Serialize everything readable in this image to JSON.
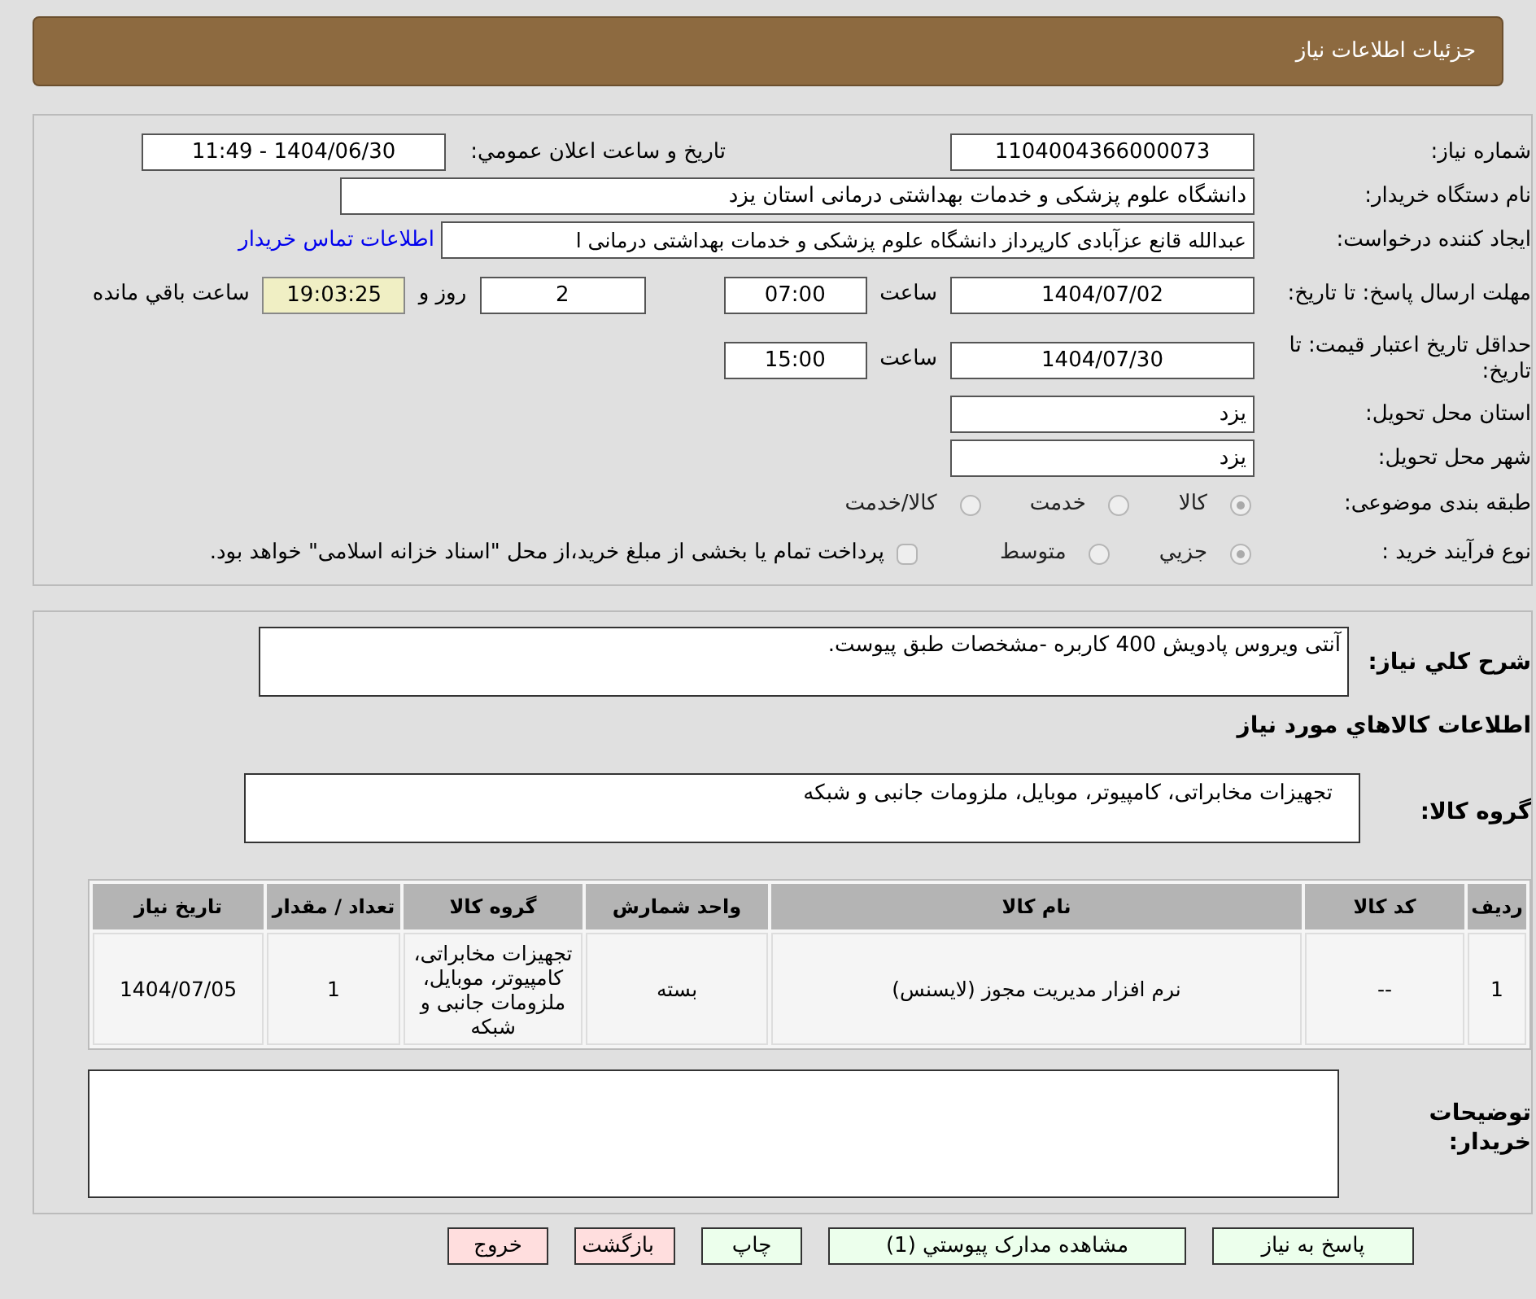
{
  "header": {
    "title": "جزئیات اطلاعات نیاز"
  },
  "need_number": {
    "label": "شماره نیاز:",
    "value": "1104004366000073"
  },
  "announce": {
    "label": "تاریخ و ساعت اعلان عمومي:",
    "value": "1404/06/30 - 11:49"
  },
  "buyer_org": {
    "label": "نام دستگاه خریدار:",
    "value": "دانشگاه علوم پزشکی و خدمات بهداشتی  درمانی استان یزد"
  },
  "requester": {
    "label": "ایجاد کننده درخواست:",
    "value": "عبدالله قانع عزآبادی کارپرداز دانشگاه علوم پزشکی و خدمات بهداشتی  درمانی ا",
    "link": "اطلاعات تماس خریدار"
  },
  "deadline": {
    "label": "مهلت ارسال پاسخ: تا تاریخ:",
    "date": "1404/07/02",
    "time_label": "ساعت",
    "time": "07:00",
    "days": "2",
    "days_label": "روز و",
    "remaining": "19:03:25",
    "remaining_label": "ساعت باقي مانده"
  },
  "validity": {
    "label": "حداقل تاریخ اعتبار قیمت: تا تاریخ:",
    "date": "1404/07/30",
    "time_label": "ساعت",
    "time": "15:00"
  },
  "province": {
    "label": "استان محل تحویل:",
    "value": "یزد"
  },
  "city": {
    "label": "شهر محل تحویل:",
    "value": "یزد"
  },
  "category": {
    "label": "طبقه بندی موضوعی:",
    "options": [
      {
        "label": "کالا",
        "selected": true
      },
      {
        "label": "خدمت",
        "selected": false
      },
      {
        "label": "کالا/خدمت",
        "selected": false
      }
    ]
  },
  "process": {
    "label": "نوع فرآیند خرید :",
    "options": [
      {
        "label": "جزيي",
        "selected": true
      },
      {
        "label": "متوسط",
        "selected": false
      }
    ],
    "payment": {
      "label": "پرداخت تمام یا بخشی از مبلغ خرید،از محل \"اسناد خزانه اسلامی\" خواهد بود.",
      "checked": false
    }
  },
  "description": {
    "label": "شرح کلي نياز:",
    "value": "آنتی ویروس پادویش 400 کاربره -مشخصات طبق پیوست."
  },
  "goods_title": "اطلاعات کالاهاي مورد نياز",
  "goods_group": {
    "label": "گروه کالا:",
    "value": "تجهیزات مخابراتی، کامپیوتر، موبایل، ملزومات جانبی و شبکه"
  },
  "table": {
    "columns": [
      "رديف",
      "کد کالا",
      "نام کالا",
      "واحد شمارش",
      "گروه کالا",
      "تعداد / مقدار",
      "تاریخ نیاز"
    ],
    "rows": [
      [
        "1",
        "--",
        "نرم افزار مدیریت مجوز (لایسنس)",
        "بسته",
        "تجهیزات مخابراتی، کامپیوتر، موبایل، ملزومات جانبی و شبکه",
        "1",
        "1404/07/05"
      ]
    ]
  },
  "buyer_notes": {
    "label": "توضیحات خریدار:"
  },
  "buttons": [
    {
      "label": "پاسخ به نیاز",
      "kind": "primary"
    },
    {
      "label": "مشاهده مدارک پیوستي (1)",
      "kind": "primary"
    },
    {
      "label": "چاپ",
      "kind": "primary"
    },
    {
      "label": "بازگشت",
      "kind": "danger"
    },
    {
      "label": "خروج",
      "kind": "danger"
    }
  ]
}
